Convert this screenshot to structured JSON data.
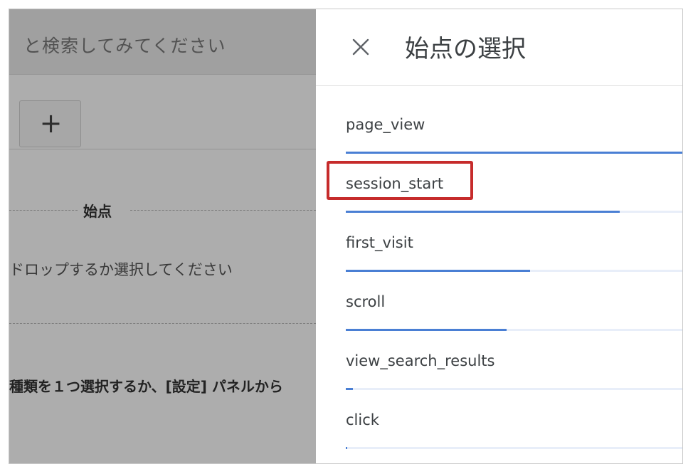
{
  "background": {
    "search_placeholder": "と検索してみてください",
    "add_button_glyph": "+",
    "start_label": "始点",
    "drop_instruction": "ドロップするか選択してください",
    "type_instruction": "種類を１つ選択するか、[設定] パネルから"
  },
  "panel": {
    "title": "始点の選択",
    "close_glyph": "×",
    "events": [
      {
        "name": "page_view",
        "fraction": 1.0
      },
      {
        "name": "session_start",
        "fraction": 0.81
      },
      {
        "name": "first_visit",
        "fraction": 0.545
      },
      {
        "name": "scroll",
        "fraction": 0.475
      },
      {
        "name": "view_search_results",
        "fraction": 0.02
      },
      {
        "name": "click",
        "fraction": 0.004
      }
    ],
    "highlighted_event": "session_start"
  },
  "colors": {
    "accent_blue": "#4a7fd4",
    "highlight_red": "#c62b2b",
    "track_light": "#e8eef9"
  }
}
